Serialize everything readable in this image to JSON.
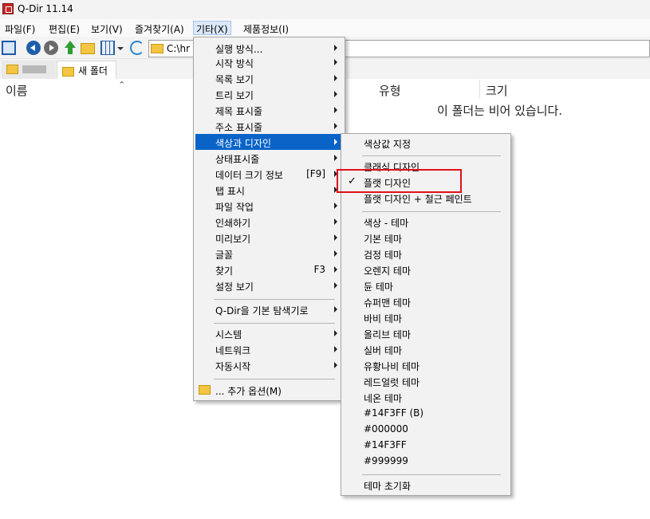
{
  "window": {
    "title": "Q-Dir 11.14"
  },
  "menubar": {
    "items": [
      "파일(F)",
      "편집(E)",
      "보기(V)",
      "즐겨찾기(A)",
      "기타(X)",
      "제품정보(I)"
    ]
  },
  "address": {
    "path": "C:\\hr"
  },
  "tabs": {
    "items": [
      "",
      "새 폴더"
    ]
  },
  "columns": {
    "name": "이름",
    "type": "유형",
    "size": "크기"
  },
  "empty_message": "이 폴더는 비어 있습니다.",
  "menu_other": {
    "items": [
      {
        "label": "실행 방식...",
        "submenu": true
      },
      {
        "label": "시작 방식",
        "submenu": true
      },
      {
        "label": "목록 보기",
        "submenu": true
      },
      {
        "label": "트리 보기",
        "submenu": true
      },
      {
        "label": "제목 표시줄",
        "submenu": true
      },
      {
        "label": "주소 표시줄",
        "submenu": true
      },
      {
        "label": "색상과 디자인",
        "submenu": true,
        "highlighted": true
      },
      {
        "label": "상태표시줄",
        "submenu": true
      },
      {
        "label": "데이터 크기 정보",
        "shortcut": "[F9]",
        "submenu": true
      },
      {
        "label": "탭 표시",
        "submenu": true
      },
      {
        "label": "파일 작업",
        "submenu": true
      },
      {
        "label": "인쇄하기",
        "submenu": true
      },
      {
        "label": "미리보기",
        "submenu": true
      },
      {
        "label": "글꼴",
        "submenu": true
      },
      {
        "label": "찾기",
        "shortcut": "F3",
        "submenu": true
      },
      {
        "label": "설정 보기",
        "submenu": true
      },
      {
        "label": "Q-Dir을 기본 탐색기로",
        "submenu": true
      },
      {
        "label": "시스템",
        "submenu": true
      },
      {
        "label": "네트워크",
        "submenu": true
      },
      {
        "label": "자동시작",
        "submenu": true
      },
      {
        "label": "... 추가 옵션(M)",
        "icon": "folder-icon"
      }
    ]
  },
  "menu_color": {
    "items": [
      {
        "label": "색상값 지정"
      },
      {
        "label": "클래식 디자인"
      },
      {
        "label": "플랫 디자인",
        "checked": true
      },
      {
        "label": "플랫 디자인 + 철근 페인트"
      },
      {
        "label": "색상 - 테마"
      },
      {
        "label": "기본 테마"
      },
      {
        "label": "검정 테마"
      },
      {
        "label": "오렌지 테마"
      },
      {
        "label": "듄 테마"
      },
      {
        "label": "슈퍼맨 테마"
      },
      {
        "label": "바비 테마"
      },
      {
        "label": "올리브 테마"
      },
      {
        "label": "실버 테마"
      },
      {
        "label": "유황나비 테마"
      },
      {
        "label": "레드얼럿 테마"
      },
      {
        "label": "네온 테마"
      },
      {
        "label": "#14F3FF (B)"
      },
      {
        "label": "#000000"
      },
      {
        "label": "#14F3FF"
      },
      {
        "label": "#999999"
      },
      {
        "label": "테마 초기화"
      }
    ]
  },
  "colors": {
    "highlight": "#0a64c8",
    "annotation_box": "#e0101a",
    "menu_bg": "#f2f2f2"
  }
}
